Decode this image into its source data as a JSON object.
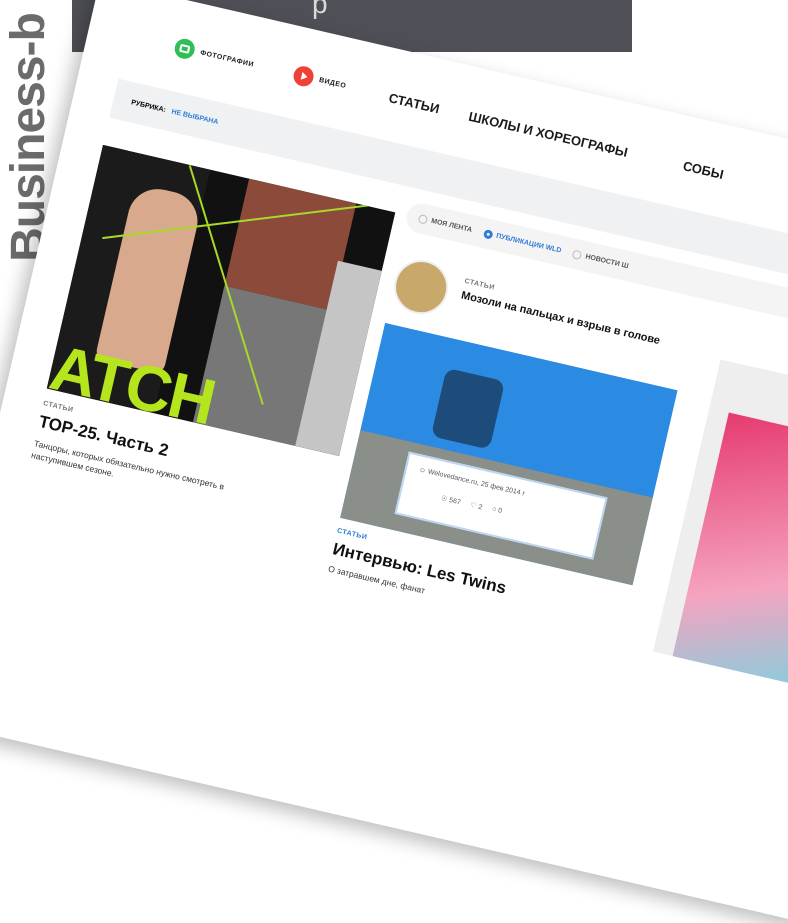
{
  "side_brand": "Business-b",
  "top_bar": {
    "text": "р"
  },
  "nav": {
    "photos": "ФОТОГРАФИИ",
    "video": "ВИДЕО",
    "articles": "СТАТЬИ",
    "schools": "ШКОЛЫ И ХОРЕОГРАФЫ",
    "events": "СОБЫ"
  },
  "rubric": {
    "label": "РУБРИКА:",
    "value": "НЕ ВЫБРАНА"
  },
  "filters": [
    {
      "label": "МОЯ ЛЕНТА",
      "selected": false
    },
    {
      "label": "ПУБЛИКАЦИИ WLD",
      "selected": true
    },
    {
      "label": "НОВОСТИ Ш",
      "selected": false
    }
  ],
  "cards": {
    "card1": {
      "collage_text": "ATCH",
      "category": "СТАТЬИ",
      "title": "ТОР-25. Часть 2",
      "desc": "Танцоры, которых обязательно нужно смотреть в наступившем сезоне."
    },
    "card2": {
      "category_top": "СТАТЬИ",
      "headline_top": "Мозоли на пальцах и взрыв в голове",
      "source": "Welovedance.ru, 25 фев 2014 г",
      "views": "567",
      "likes": "2",
      "comments": "0",
      "category": "СТАТЬИ",
      "title": "Интервью: Les Twins",
      "desc": "О затравшем дне, фанат"
    }
  },
  "colors": {
    "accent_blue": "#2e7dd6",
    "lime": "#b5e61d",
    "green": "#2fbf56",
    "red": "#ef4137"
  }
}
